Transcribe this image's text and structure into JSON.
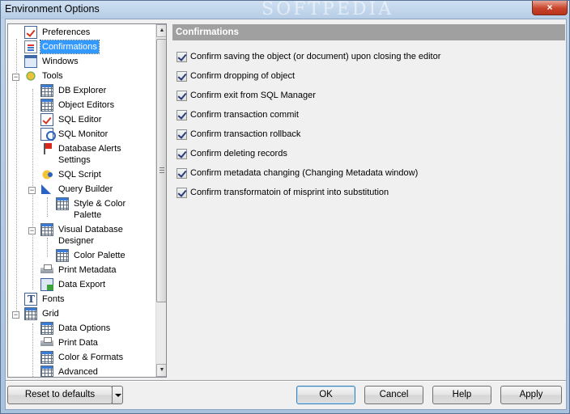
{
  "window": {
    "title": "Environment Options",
    "watermark": "SOFTPEDIA",
    "close_glyph": "×"
  },
  "tree": {
    "items": [
      {
        "label": "Preferences",
        "icon": "checklist-icon"
      },
      {
        "label": "Confirmations",
        "icon": "document-icon",
        "selected": true
      },
      {
        "label": "Windows",
        "icon": "windows-icon"
      },
      {
        "label": "Tools",
        "icon": "tools-icon",
        "expanded": true
      },
      {
        "label": "DB Explorer",
        "icon": "grid-icon"
      },
      {
        "label": "Object Editors",
        "icon": "grid-icon"
      },
      {
        "label": "SQL Editor",
        "icon": "editor-icon"
      },
      {
        "label": "SQL Monitor",
        "icon": "monitor-icon"
      },
      {
        "label": "Database Alerts",
        "label2": "Settings",
        "icon": "flag-icon"
      },
      {
        "label": "SQL Script",
        "icon": "bolt-icon"
      },
      {
        "label": "Query Builder",
        "icon": "query-builder-icon",
        "expanded": true
      },
      {
        "label": "Style & Color",
        "label2": "Palette",
        "icon": "grid-icon"
      },
      {
        "label": "Visual Database",
        "label2": "Designer",
        "icon": "designer-icon",
        "expanded": true
      },
      {
        "label": "Color Palette",
        "icon": "grid-icon"
      },
      {
        "label": "Print Metadata",
        "icon": "printer-icon"
      },
      {
        "label": "Data Export",
        "icon": "export-icon"
      },
      {
        "label": "Fonts",
        "icon": "font-icon"
      },
      {
        "label": "Grid",
        "icon": "grid-icon",
        "expanded": true
      },
      {
        "label": "Data Options",
        "icon": "grid-icon"
      },
      {
        "label": "Print Data",
        "icon": "printer-icon"
      },
      {
        "label": "Color & Formats",
        "icon": "grid-icon"
      },
      {
        "label": "Advanced",
        "icon": "grid-icon"
      }
    ],
    "expander_minus": "−"
  },
  "panel": {
    "header": "Confirmations",
    "options": [
      {
        "label": "Confirm saving the object (or document) upon closing the editor",
        "checked": true
      },
      {
        "label": "Confirm dropping of object",
        "checked": true
      },
      {
        "label": "Confirm exit from SQL Manager",
        "checked": true
      },
      {
        "label": "Confirm transaction commit",
        "checked": true
      },
      {
        "label": "Confirm transaction rollback",
        "checked": true
      },
      {
        "label": "Confirm deleting records",
        "checked": true
      },
      {
        "label": "Confirm metadata changing (Changing Metadata window)",
        "checked": true
      },
      {
        "label": "Confirm transformatoin of misprint into substitution",
        "checked": true
      }
    ]
  },
  "buttons": {
    "reset": "Reset to defaults",
    "ok": "OK",
    "cancel": "Cancel",
    "help": "Help",
    "apply": "Apply"
  },
  "scrollbar": {
    "up_glyph": "▲",
    "down_glyph": "▼"
  }
}
